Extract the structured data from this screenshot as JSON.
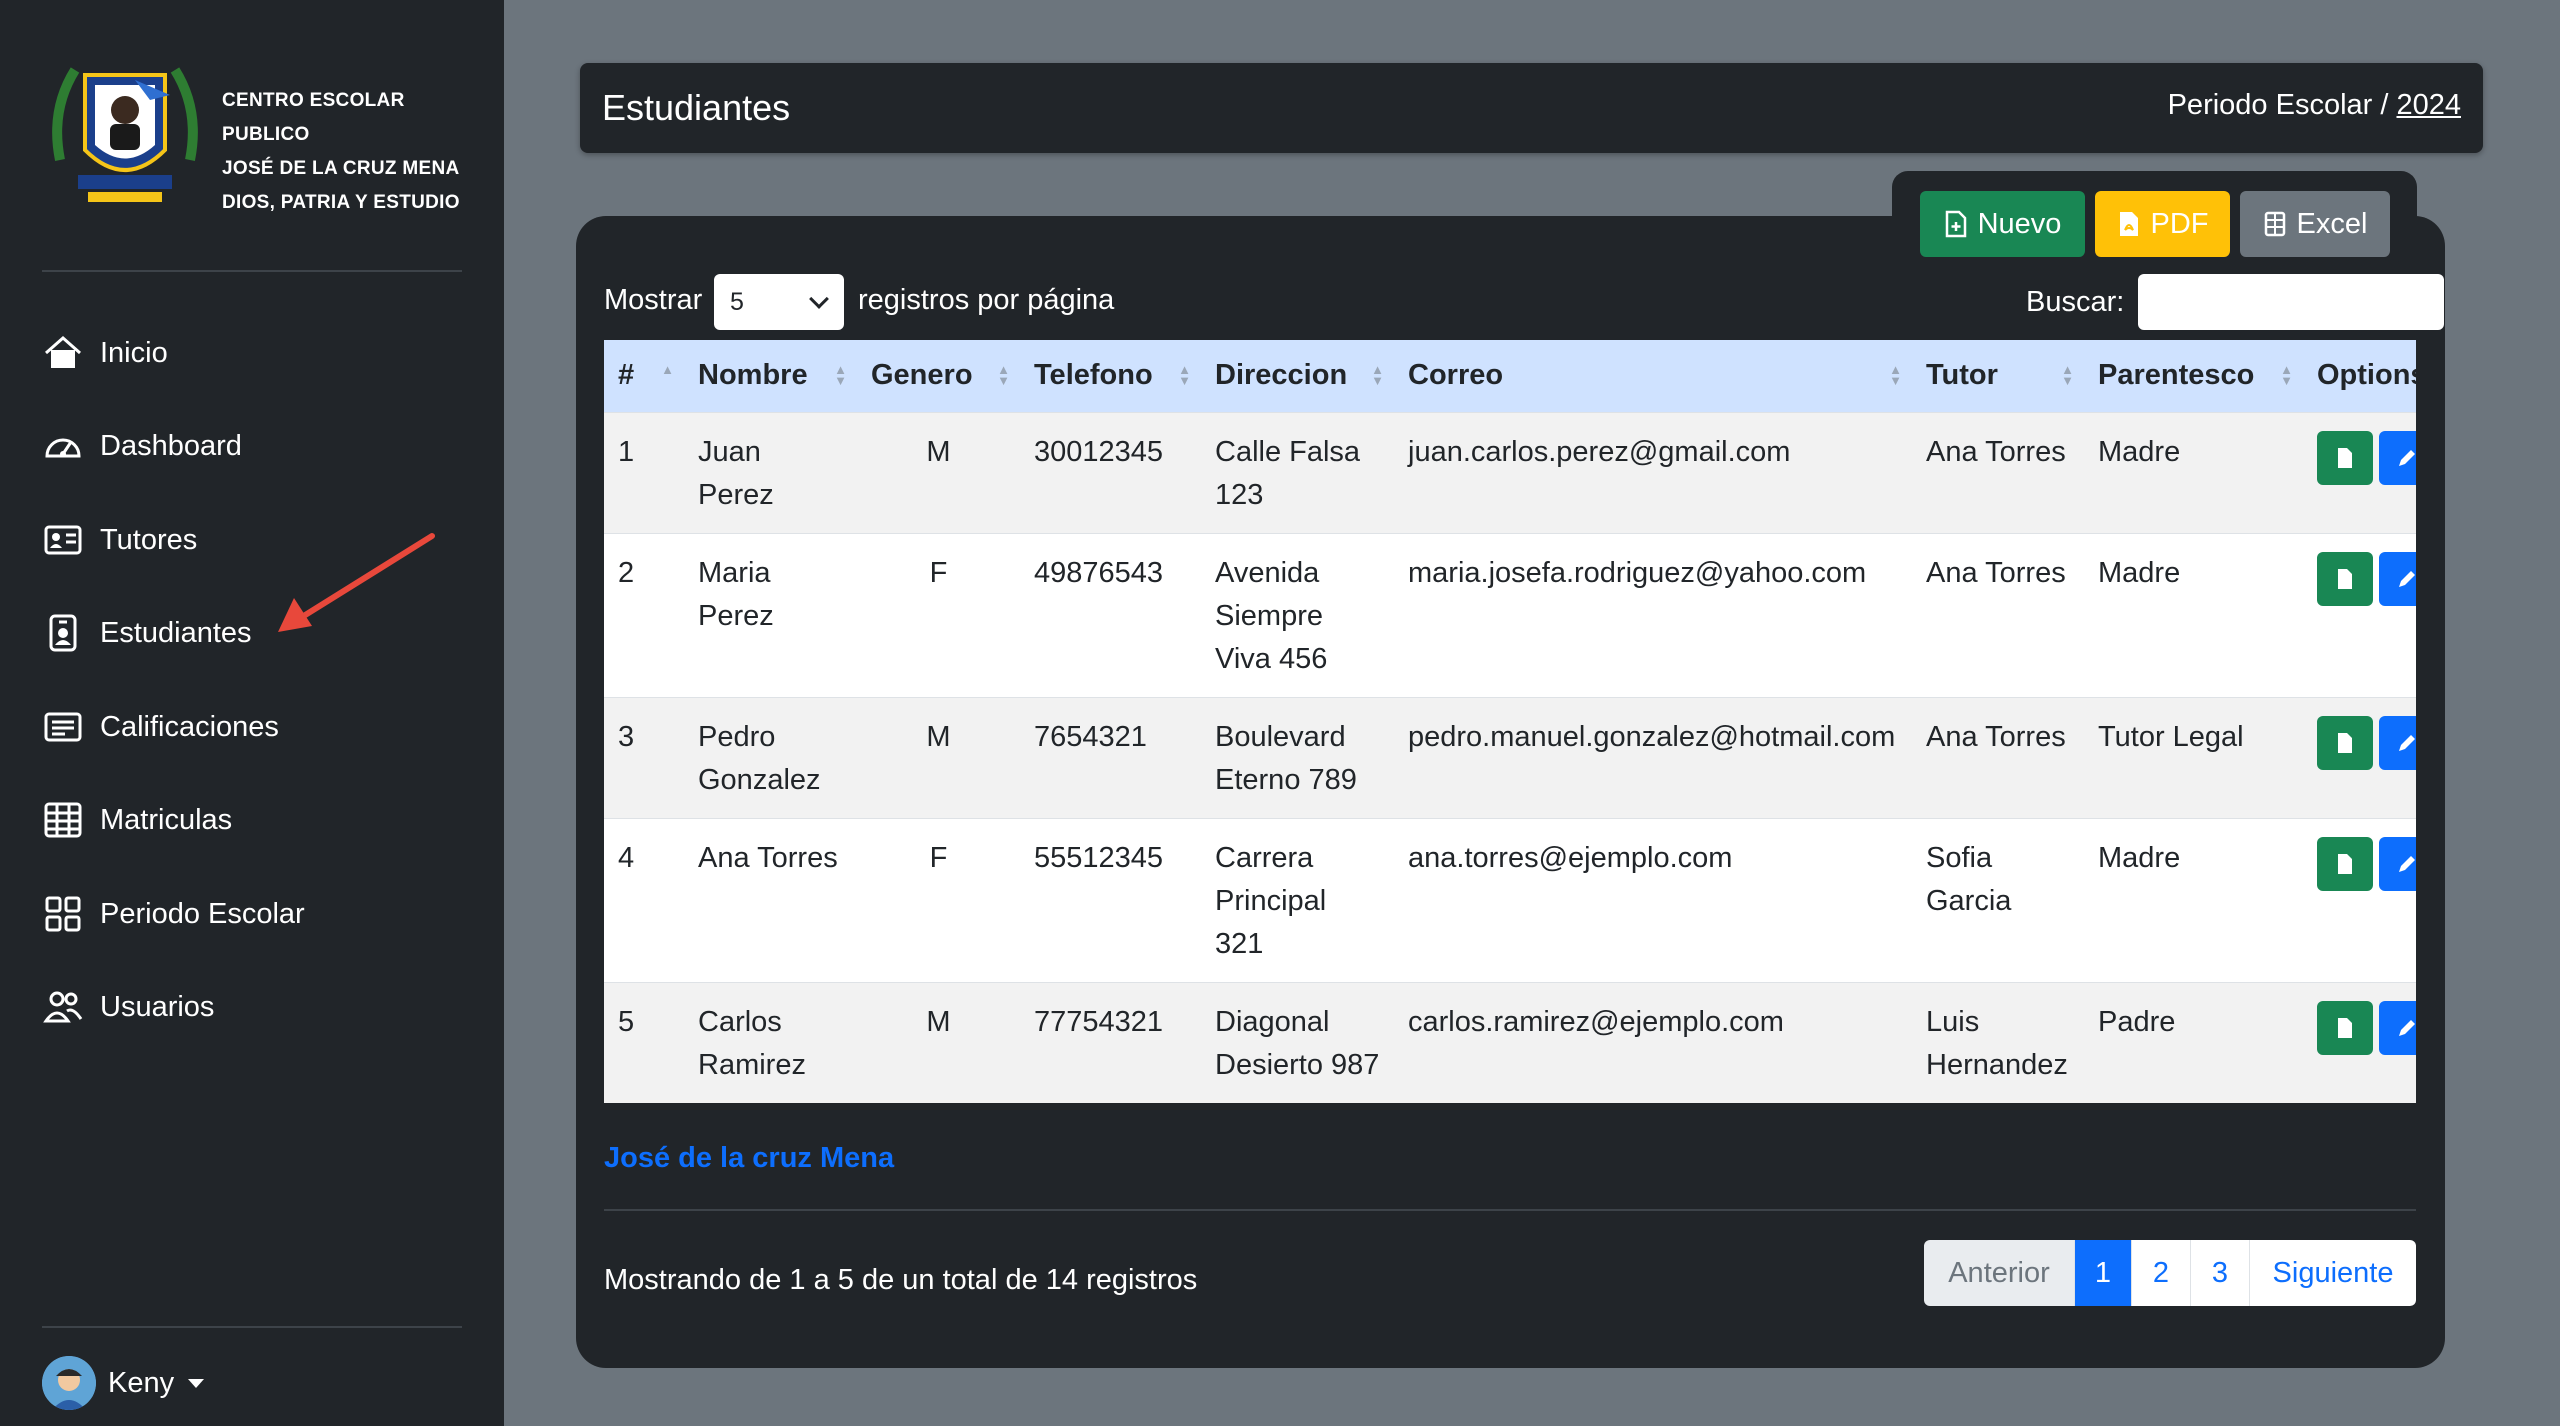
{
  "brand": {
    "line1": "CENTRO ESCOLAR PUBLICO",
    "line2": "JOSÉ DE LA CRUZ MENA",
    "line3": "DIOS, PATRIA Y ESTUDIO"
  },
  "sidebar": {
    "items": [
      {
        "label": "Inicio",
        "icon": "house-icon"
      },
      {
        "label": "Dashboard",
        "icon": "speedometer-icon"
      },
      {
        "label": "Tutores",
        "icon": "person-vcard-icon"
      },
      {
        "label": "Estudiantes",
        "icon": "person-badge-icon"
      },
      {
        "label": "Calificaciones",
        "icon": "card-text-icon"
      },
      {
        "label": "Matriculas",
        "icon": "table-icon"
      },
      {
        "label": "Periodo Escolar",
        "icon": "grid-icon"
      },
      {
        "label": "Usuarios",
        "icon": "people-icon"
      }
    ],
    "user": "Keny"
  },
  "header": {
    "title": "Estudiantes",
    "period_label": "Periodo Escolar / ",
    "period_year": "2024"
  },
  "toolbar": {
    "new_label": "Nuevo",
    "pdf_label": "PDF",
    "excel_label": "Excel"
  },
  "controls": {
    "show_label": "Mostrar",
    "page_size": "5",
    "per_page_label": "registros por página",
    "search_label": "Buscar:",
    "search_value": ""
  },
  "table": {
    "columns": [
      "#",
      "Nombre",
      "Genero",
      "Telefono",
      "Direccion",
      "Correo",
      "Tutor",
      "Parentesco",
      "Options"
    ],
    "rows": [
      {
        "num": "1",
        "nombre": "Juan Perez",
        "genero": "M",
        "telefono": "30012345",
        "direccion": "Calle Falsa 123",
        "correo": "juan.carlos.perez@gmail.com",
        "tutor": "Ana Torres",
        "parentesco": "Madre"
      },
      {
        "num": "2",
        "nombre": "Maria Perez",
        "genero": "F",
        "telefono": "49876543",
        "direccion": "Avenida Siempre Viva 456",
        "correo": "maria.josefa.rodriguez@yahoo.com",
        "tutor": "Ana Torres",
        "parentesco": "Madre"
      },
      {
        "num": "3",
        "nombre": "Pedro Gonzalez",
        "genero": "M",
        "telefono": "7654321",
        "direccion": "Boulevard Eterno 789",
        "correo": "pedro.manuel.gonzalez@hotmail.com",
        "tutor": "Ana Torres",
        "parentesco": "Tutor Legal"
      },
      {
        "num": "4",
        "nombre": "Ana Torres",
        "genero": "F",
        "telefono": "55512345",
        "direccion": "Carrera Principal 321",
        "correo": "ana.torres@ejemplo.com",
        "tutor": "Sofia Garcia",
        "parentesco": "Madre"
      },
      {
        "num": "5",
        "nombre": "Carlos Ramirez",
        "genero": "M",
        "telefono": "77754321",
        "direccion": "Diagonal Desierto 987",
        "correo": "carlos.ramirez@ejemplo.com",
        "tutor": "Luis Hernandez",
        "parentesco": "Padre"
      }
    ]
  },
  "footer": {
    "link": "José de la cruz Mena",
    "info": "Mostrando de 1 a 5 de un total de 14 registros",
    "pagination": {
      "prev": "Anterior",
      "pages": [
        "1",
        "2",
        "3"
      ],
      "next": "Siguiente"
    }
  },
  "colors": {
    "sidebar_bg": "#212529",
    "page_bg": "#6c757d",
    "header_row": "#cfe2ff",
    "green": "#198754",
    "yellow": "#ffc107",
    "blue": "#0d6efd",
    "arrow": "#e8483b"
  }
}
